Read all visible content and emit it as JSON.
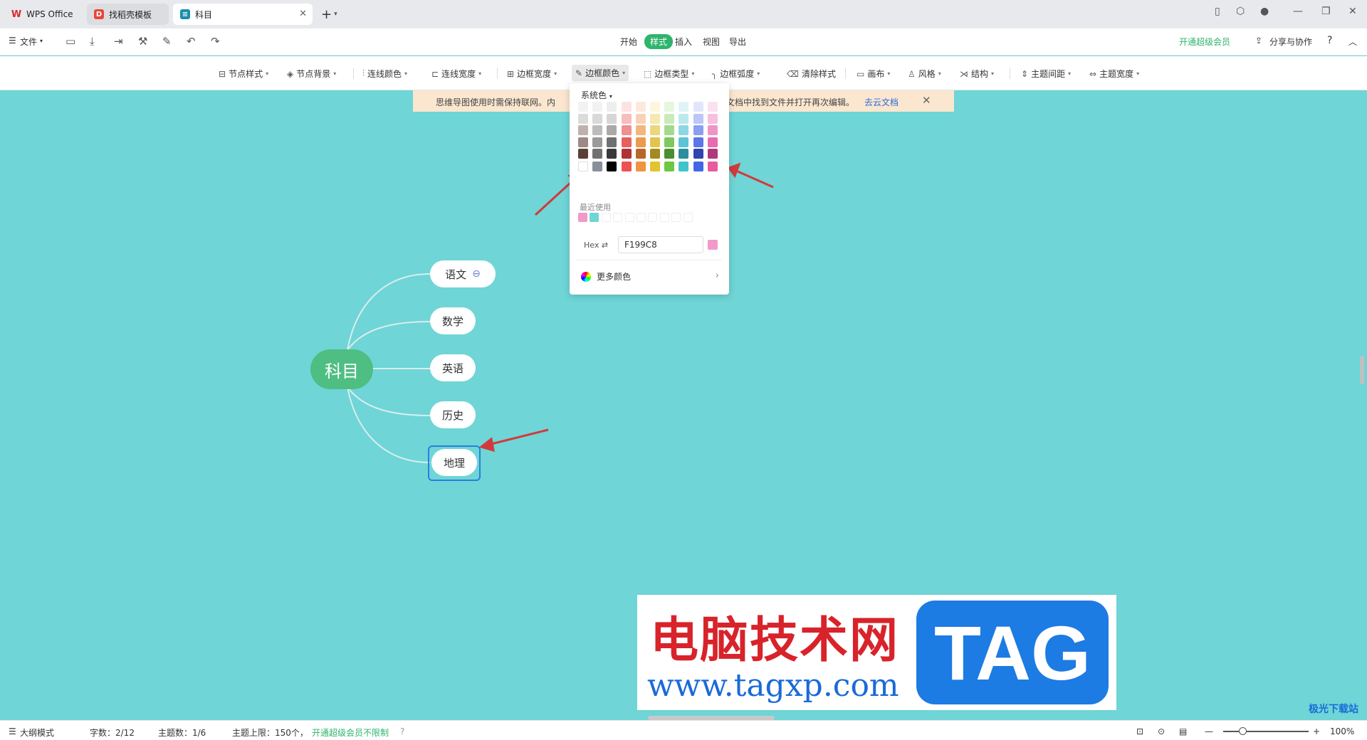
{
  "tabs": [
    {
      "label": "WPS Office"
    },
    {
      "label": "找稻壳模板"
    },
    {
      "label": "科目"
    }
  ],
  "menu": {
    "file": "文件",
    "tabs": [
      "开始",
      "样式",
      "插入",
      "视图",
      "导出"
    ],
    "active_tab": "样式",
    "vip": "开通超级会员",
    "share": "分享与协作",
    "help": "?"
  },
  "toolbar": [
    {
      "label": "节点样式"
    },
    {
      "label": "节点背景"
    },
    {
      "label": "连线颜色"
    },
    {
      "label": "连线宽度"
    },
    {
      "label": "边框宽度"
    },
    {
      "label": "边框颜色"
    },
    {
      "label": "边框类型"
    },
    {
      "label": "边框弧度"
    },
    {
      "label": "清除样式"
    },
    {
      "label": "画布"
    },
    {
      "label": "风格"
    },
    {
      "label": "结构"
    },
    {
      "label": "主题间距"
    },
    {
      "label": "主题宽度"
    }
  ],
  "banner": {
    "text1": "思维导图使用时需保持联网。内",
    "text2": "文档中找到文件并打开再次编辑。",
    "link": "去云文档"
  },
  "mindmap": {
    "root": "科目",
    "children": [
      "语文",
      "数学",
      "英语",
      "历史",
      "地理"
    ]
  },
  "color_popup": {
    "header": "系统色",
    "recent_label": "最近使用",
    "hex_label": "Hex",
    "hex_value": "F199C8",
    "more_label": "更多颜色",
    "preview_color": "#F199C8",
    "grid_colors": [
      [
        "#f2f2f2",
        "#f2f2f2",
        "#eeeeee",
        "#fde2e2",
        "#fde9dc",
        "#fdf6dc",
        "#e6f6df",
        "#dff4f7",
        "#e1e6fb",
        "#fbe0ef"
      ],
      [
        "#dbdbdb",
        "#d9d9d9",
        "#d6d6d6",
        "#f7bcbc",
        "#f8d2b6",
        "#f5e8b0",
        "#c9ebbb",
        "#bde8ef",
        "#bcc7f5",
        "#f5bfdd"
      ],
      [
        "#bfb1ad",
        "#bcbcbc",
        "#a9a9a9",
        "#f08f8f",
        "#f2b67f",
        "#ecd67e",
        "#a3d98c",
        "#8dd6e3",
        "#8b9eef",
        "#ef95c6"
      ],
      [
        "#9d8a84",
        "#9a9a9a",
        "#707070",
        "#e85f5f",
        "#ec9a4f",
        "#e2c44e",
        "#7ec85f",
        "#5cc4d6",
        "#5c76e8",
        "#e96baf"
      ],
      [
        "#5b4038",
        "#717171",
        "#3a3a3a",
        "#b03333",
        "#b86728",
        "#a38b20",
        "#4a8f2f",
        "#2e8e9e",
        "#2f46ae",
        "#ae3a7b"
      ],
      [
        "#ffffff",
        "#8a9099",
        "#000000",
        "#ed5252",
        "#ef9440",
        "#e2c431",
        "#6bc840",
        "#40c4cc",
        "#4167e8",
        "#ea5a9e"
      ]
    ],
    "recent_colors": [
      "#F199C8",
      "#6FD5D6",
      "",
      "",
      "",
      "",
      "",
      "",
      "",
      ""
    ]
  },
  "watermark": {
    "cn": "电脑技术网",
    "url": "www.tagxp.com",
    "tag": "TAG"
  },
  "corner_watermark": "极光下载站",
  "status": {
    "outline": "大纲模式",
    "words": "字数：2/12",
    "topics": "主题数：1/6",
    "limit": "主题上限：150个，",
    "vip": "开通超级会员不限制",
    "zoom": "100%"
  },
  "colors": {
    "canvas": "#6fd5d6",
    "accent": "#2fb46c",
    "root_node": "#4fbe83",
    "selection": "#2a7fe0"
  }
}
